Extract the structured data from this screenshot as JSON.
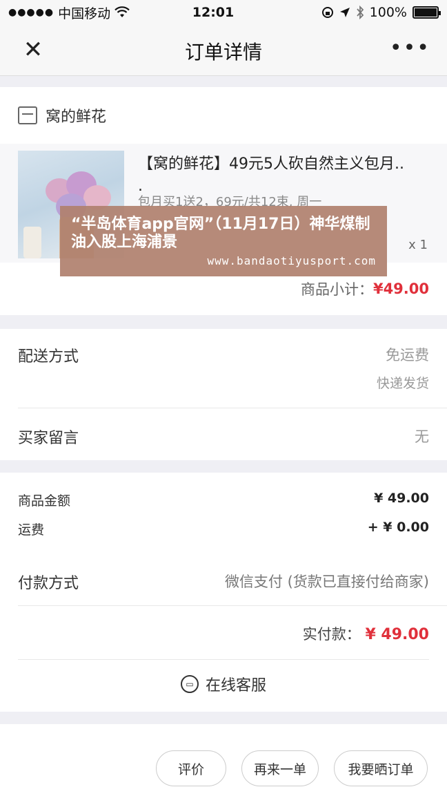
{
  "status_bar": {
    "carrier": "中国移动",
    "time": "12:01",
    "battery": "100%"
  },
  "nav": {
    "title": "订单详情",
    "close_icon": "close-icon",
    "more_icon": "more-icon"
  },
  "shop": {
    "name": "窝的鲜花",
    "icon": "shop-icon"
  },
  "product": {
    "title": "【窝的鲜花】49元5人砍自然主义包月..",
    "title_cont": ".",
    "sku": "包月买1送2，69元/共12束, 周一",
    "qty": "x 1"
  },
  "subtotal": {
    "label": "商品小计：",
    "value": "¥49.00"
  },
  "delivery": {
    "label": "配送方式",
    "fee": "免运费",
    "method": "快递发货"
  },
  "message": {
    "label": "买家留言",
    "value": "无"
  },
  "amounts": {
    "goods_label": "商品金额",
    "goods_value": "¥ 49.00",
    "shipping_label": "运费",
    "shipping_value": "+ ¥ 0.00"
  },
  "pay_method": {
    "label": "付款方式",
    "value": "微信支付 (货款已直接付给商家)"
  },
  "paid": {
    "label": "实付款：",
    "value": "¥ 49.00"
  },
  "service": {
    "label": "在线客服",
    "icon": "chat-icon"
  },
  "actions": {
    "review": "评价",
    "reorder": "再来一单",
    "share": "我要晒订单"
  },
  "banner": {
    "title": "“半岛体育app官网”（11月17日）神华煤制油入股上海浦景",
    "url": "www.bandaotiyusport.com"
  },
  "colors": {
    "accent_red": "#e0303b",
    "banner_bg": "#b0806e"
  }
}
